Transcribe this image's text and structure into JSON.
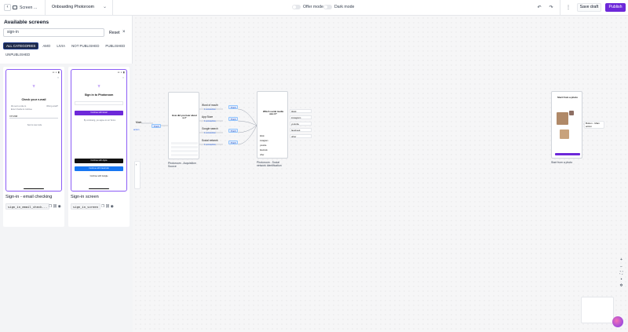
{
  "topbar": {
    "back_icon": "chevron-left-icon",
    "screen_label": "Screen ...",
    "project_name": "Onboarding Photoroom",
    "offer_mode_label": "Offer mode",
    "dark_mode_label": "Dark mode",
    "save_draft_label": "Save draft",
    "publish_label": "Publish",
    "accent_color": "#6d28d9"
  },
  "panel": {
    "title": "Available screens",
    "search_value": "sign-in",
    "reset_label": "Reset",
    "chips": [
      "ALL CATEGORIES",
      "AMO",
      "LIVIA",
      "NOT PUBLISHED",
      "PUBLISHED",
      "UNPUBLISHED"
    ],
    "cards": [
      {
        "name": "Sign-in - email checking",
        "id": "sign_in_email_check...",
        "phone_title": "Check your e-mail",
        "phone_body_left": "We sent a code to",
        "phone_body_right": "Wrong email?",
        "phone_body_2": "Enter it below to continue",
        "field_value": "XXYZAB",
        "resend": "Send a new code"
      },
      {
        "name": "Sign-in screen",
        "id": "sign_in_screen",
        "phone_title": "Sign in to Photoroom",
        "primary_button": "Continue with Email",
        "apple_button": "Continue with Apple",
        "facebook_button": "Continue with Facebook",
        "google_button": "Continue with Google",
        "terms": "By continuing, you agree to our Terms"
      }
    ]
  },
  "canvas": {
    "left_stub": "Main",
    "left_stub_2": "action",
    "push_labels": [
      "Push",
      "Push",
      "Push",
      "Push",
      "Push"
    ],
    "node1": {
      "question": "How did you hear about us?",
      "caption": "Photoroom - Acquisition Source",
      "options": [
        "Word of mouth",
        "App Store",
        "Google search",
        "Social network"
      ],
      "connection": "1 connection"
    },
    "node2": {
      "question": "Which social media was it?",
      "caption": "Photoroom - Social network identification",
      "options": [
        "tiktok",
        "instagram",
        "youtube",
        "facebook",
        "other"
      ]
    },
    "node3": {
      "title": "Start from a photo",
      "caption": "Start from a photo",
      "side_label": "Button - Main action"
    }
  }
}
